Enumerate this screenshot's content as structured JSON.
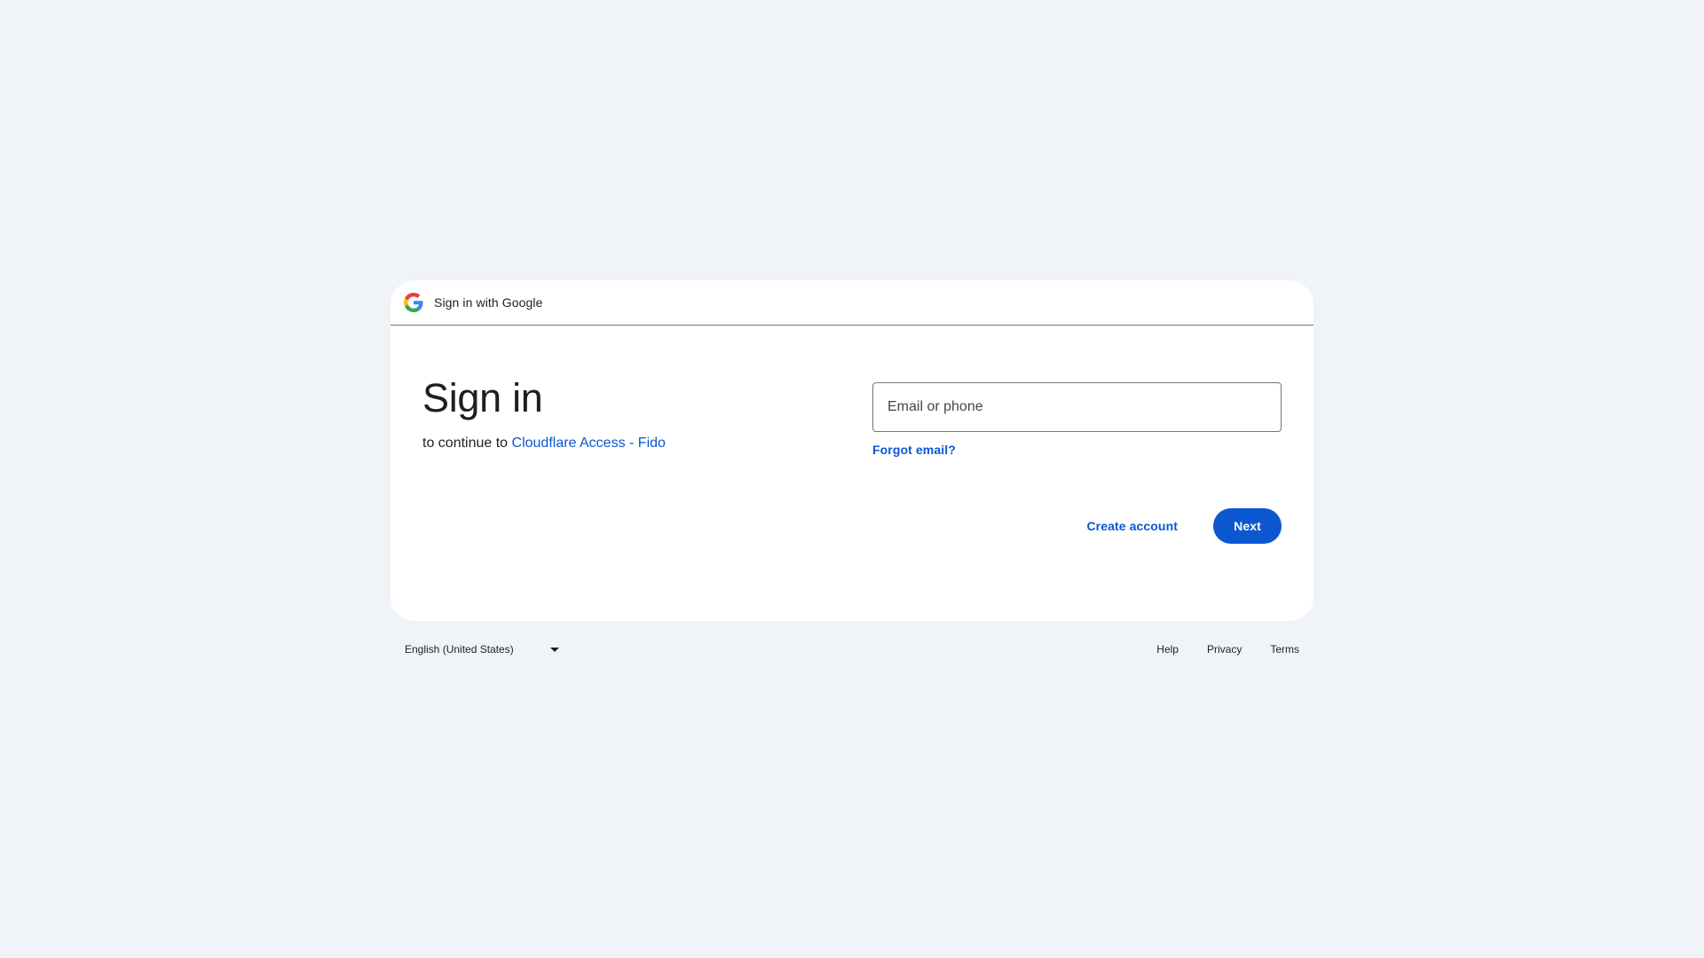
{
  "header": {
    "logo_icon": "google-g-icon",
    "title": "Sign in with Google"
  },
  "main": {
    "heading": "Sign in",
    "subtitle_prefix": "to continue to ",
    "app_name": "Cloudflare Access - Fido"
  },
  "form": {
    "email_placeholder": "Email or phone",
    "email_value": "",
    "forgot_email": "Forgot email?"
  },
  "actions": {
    "create_account": "Create account",
    "next": "Next"
  },
  "footer": {
    "language": "English (United States)",
    "links": [
      "Help",
      "Privacy",
      "Terms"
    ]
  },
  "colors": {
    "background": "#f0f4f9",
    "card": "#ffffff",
    "accent": "#0b57d0",
    "text": "#1f1f1f",
    "border": "#747775"
  }
}
